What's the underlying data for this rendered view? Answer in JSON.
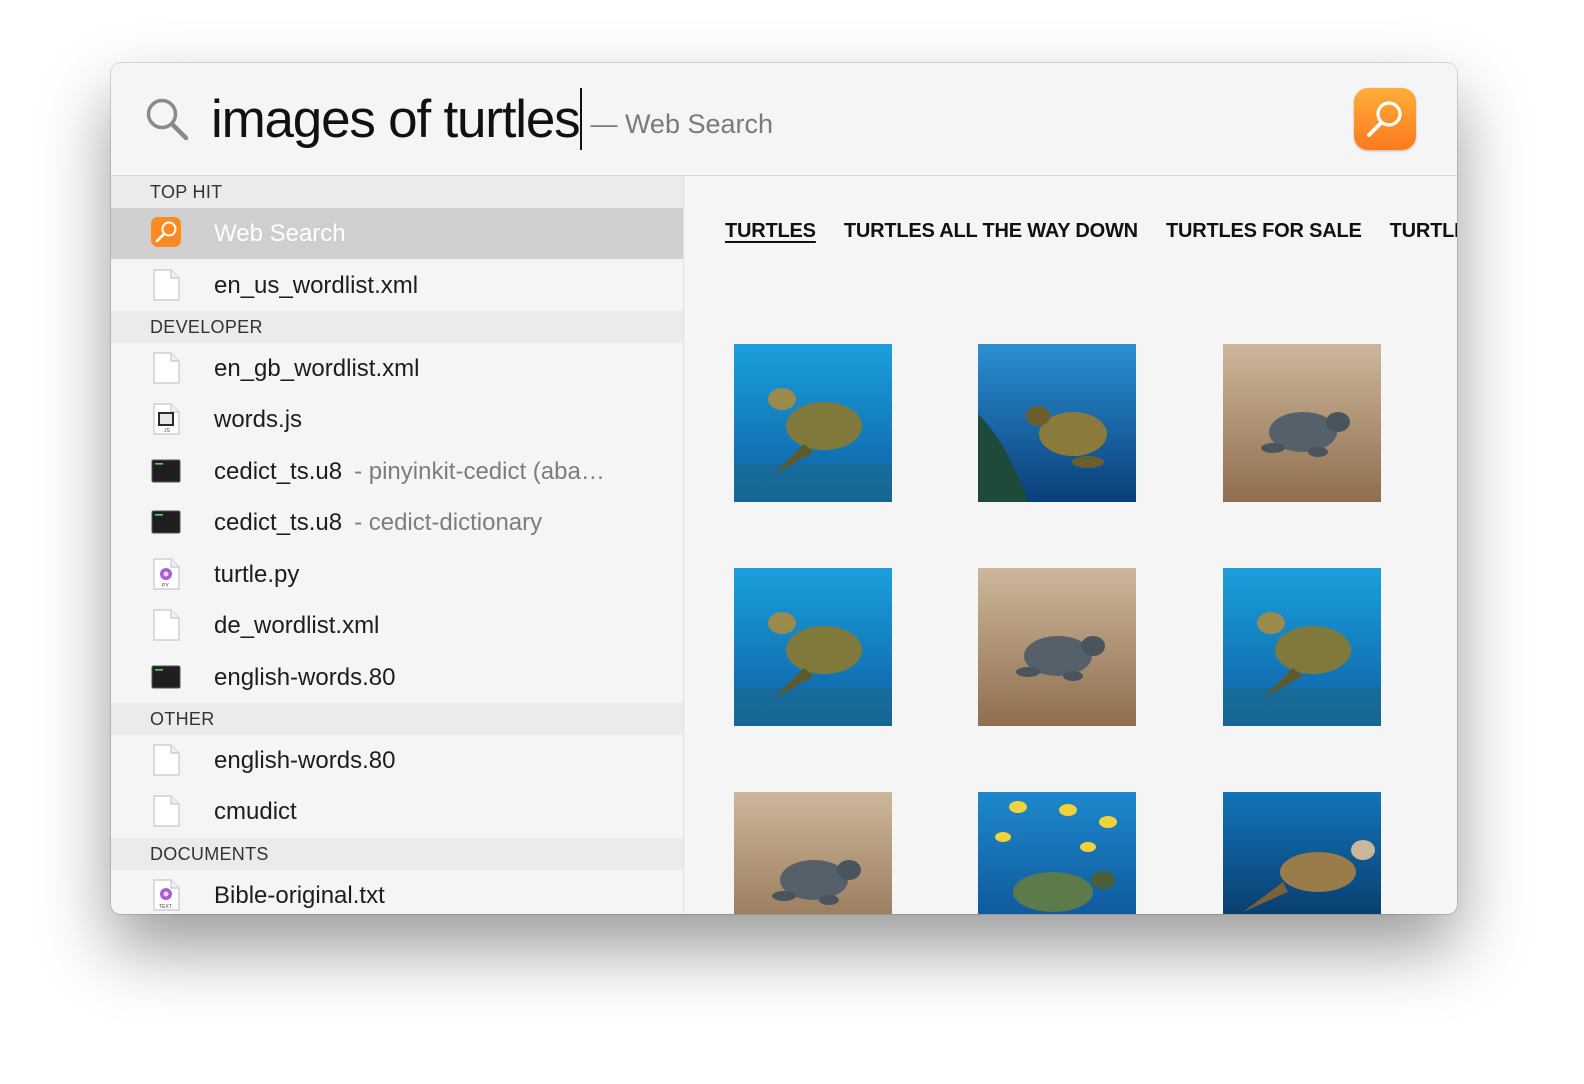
{
  "search": {
    "query": "images of turtles",
    "hint": "— Web Search",
    "glass_icon": "search-icon",
    "app_icon": "web-search-app-icon"
  },
  "sidebar": {
    "sections": [
      {
        "id": "top-hit",
        "title": "TOP HIT"
      },
      {
        "id": "developer",
        "title": "DEVELOPER"
      },
      {
        "id": "other",
        "title": "OTHER"
      },
      {
        "id": "documents",
        "title": "DOCUMENTS"
      }
    ],
    "items": [
      {
        "label": "Web Search",
        "detail": "",
        "icon": "web-search-icon",
        "selected": true
      },
      {
        "label": "en_us_wordlist.xml",
        "detail": "",
        "icon": "document-icon"
      },
      {
        "label": "en_gb_wordlist.xml",
        "detail": "",
        "icon": "document-icon"
      },
      {
        "label": "words.js",
        "detail": "",
        "icon": "js-file-icon"
      },
      {
        "label": "cedict_ts.u8",
        "detail": "- pinyinkit-cedict (aba…",
        "icon": "terminal-file-icon"
      },
      {
        "label": "cedict_ts.u8",
        "detail": "- cedict-dictionary",
        "icon": "terminal-file-icon"
      },
      {
        "label": "turtle.py",
        "detail": "",
        "icon": "python-file-icon"
      },
      {
        "label": "de_wordlist.xml",
        "detail": "",
        "icon": "document-icon"
      },
      {
        "label": "english-words.80",
        "detail": "",
        "icon": "terminal-file-icon"
      },
      {
        "label": "english-words.80",
        "detail": "",
        "icon": "document-icon"
      },
      {
        "label": "cmudict",
        "detail": "",
        "icon": "document-icon"
      },
      {
        "label": "Bible-original.txt",
        "detail": "",
        "icon": "text-file-icon"
      }
    ]
  },
  "results": {
    "tabs": [
      "TURTLES",
      "TURTLES ALL THE WAY DOWN",
      "TURTLES FOR SALE",
      "TURTLES"
    ],
    "active_tab": 0,
    "images": [
      {
        "name": "sea-turtle-image",
        "scene": "sea"
      },
      {
        "name": "sea-turtle-image",
        "scene": "reef"
      },
      {
        "name": "baby-turtle-image",
        "scene": "sand"
      },
      {
        "name": "sea-turtle-image",
        "scene": "sea"
      },
      {
        "name": "baby-turtle-image",
        "scene": "sand"
      },
      {
        "name": "sea-turtle-image",
        "scene": "sea"
      },
      {
        "name": "baby-turtle-image",
        "scene": "sand"
      },
      {
        "name": "sea-turtle-image",
        "scene": "fish"
      },
      {
        "name": "sea-turtle-image",
        "scene": "deep"
      }
    ]
  },
  "colors": {
    "accent": "#fb8a22",
    "selection": "#cfcfcf",
    "section_bg": "#ebebeb"
  }
}
